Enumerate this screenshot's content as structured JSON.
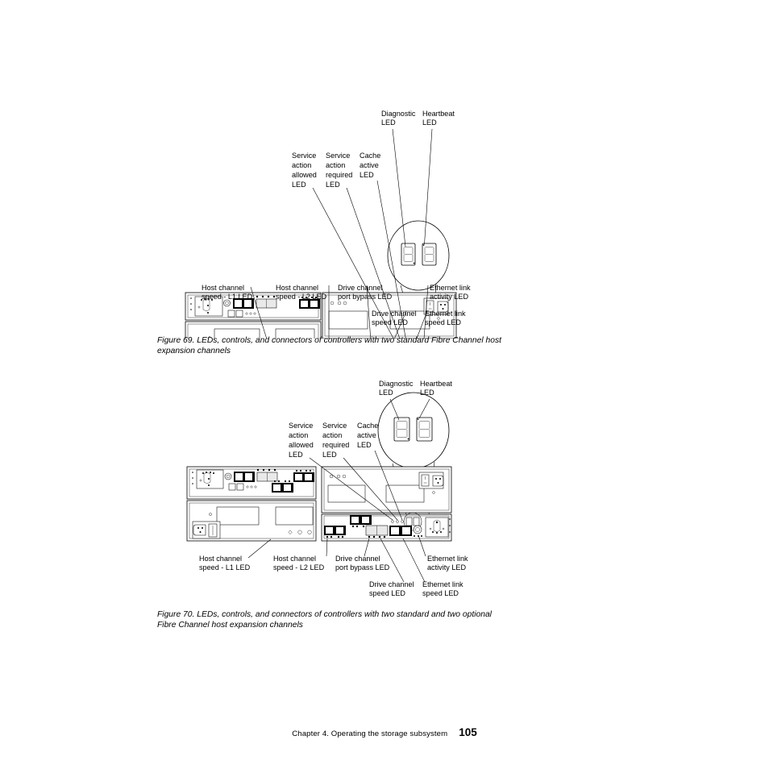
{
  "document": {
    "footer_chapter": "Chapter 4. Operating the storage subsystem",
    "footer_page_number": "105"
  },
  "figures": [
    {
      "id": "figure-69",
      "caption": "Figure 69. LEDs, controls, and connectors of controllers with two standard Fibre Channel host expansion channels",
      "callouts_top": [
        {
          "name": "diagnostic-led",
          "lines": [
            "Diagnostic",
            "LED"
          ]
        },
        {
          "name": "heartbeat-led",
          "lines": [
            "Heartbeat",
            "LED"
          ]
        },
        {
          "name": "service-action-allowed-led",
          "lines": [
            "Service",
            "action",
            "allowed",
            "LED"
          ]
        },
        {
          "name": "service-action-required-led",
          "lines": [
            "Service",
            "action",
            "required",
            "LED"
          ]
        },
        {
          "name": "cache-active-led",
          "lines": [
            "Cache",
            "active",
            "LED"
          ]
        }
      ],
      "callouts_bottom": [
        {
          "name": "host-channel-speed-l1-led",
          "lines": [
            "Host channel",
            "speed - L1 LED"
          ]
        },
        {
          "name": "host-channel-speed-l2-led",
          "lines": [
            "Host channel",
            "speed - L2 LED"
          ]
        },
        {
          "name": "drive-channel-port-bypass-led",
          "lines": [
            "Drive channel",
            "port bypass LED"
          ]
        },
        {
          "name": "ethernet-link-activity-led",
          "lines": [
            "Ethernet link",
            "activity LED"
          ]
        },
        {
          "name": "drive-channel-speed-led",
          "lines": [
            "Drive channel",
            "speed LED"
          ]
        },
        {
          "name": "ethernet-link-speed-led",
          "lines": [
            "Ethernet link",
            "speed LED"
          ]
        }
      ]
    },
    {
      "id": "figure-70",
      "caption": "Figure 70. LEDs, controls, and connectors of controllers with two standard and two optional Fibre Channel host expansion channels",
      "callouts_top": [
        {
          "name": "diagnostic-led",
          "lines": [
            "Diagnostic",
            "LED"
          ]
        },
        {
          "name": "heartbeat-led",
          "lines": [
            "Heartbeat",
            "LED"
          ]
        },
        {
          "name": "service-action-allowed-led",
          "lines": [
            "Service",
            "action",
            "allowed",
            "LED"
          ]
        },
        {
          "name": "service-action-required-led",
          "lines": [
            "Service",
            "action",
            "required",
            "LED"
          ]
        },
        {
          "name": "cache-active-led",
          "lines": [
            "Cache",
            "active",
            "LED"
          ]
        }
      ],
      "callouts_bottom": [
        {
          "name": "host-channel-speed-l1-led",
          "lines": [
            "Host channel",
            "speed - L1 LED"
          ]
        },
        {
          "name": "host-channel-speed-l2-led",
          "lines": [
            "Host channel",
            "speed - L2 LED"
          ]
        },
        {
          "name": "drive-channel-port-bypass-led",
          "lines": [
            "Drive channel",
            "port bypass LED"
          ]
        },
        {
          "name": "ethernet-link-activity-led",
          "lines": [
            "Ethernet link",
            "activity LED"
          ]
        },
        {
          "name": "drive-channel-speed-led",
          "lines": [
            "Drive channel",
            "speed LED"
          ]
        },
        {
          "name": "ethernet-link-speed-led",
          "lines": [
            "Ethernet link",
            "speed LED"
          ]
        }
      ]
    }
  ],
  "fig69": {
    "t_diag_1": "Diagnostic",
    "t_diag_2": "LED",
    "t_heart_1": "Heartbeat",
    "t_heart_2": "LED",
    "t_saa_1": "Service",
    "t_saa_2": "action",
    "t_saa_3": "allowed",
    "t_saa_4": "LED",
    "t_sar_1": "Service",
    "t_sar_2": "action",
    "t_sar_3": "required",
    "t_sar_4": "LED",
    "t_cache_1": "Cache",
    "t_cache_2": "active",
    "t_cache_3": "LED",
    "b_hc1_1": "Host channel",
    "b_hc1_2": "speed - L1 LED",
    "b_hc2_1": "Host channel",
    "b_hc2_2": "speed - L2 LED",
    "b_dcpb_1": "Drive channel",
    "b_dcpb_2": "port bypass LED",
    "b_ela_1": "Ethernet link",
    "b_ela_2": "activity LED",
    "b_dcs_1": "Drive channel",
    "b_dcs_2": "speed LED",
    "b_els_1": "Ethernet link",
    "b_els_2": "speed LED"
  },
  "fig70": {
    "t_diag_1": "Diagnostic",
    "t_diag_2": "LED",
    "t_heart_1": "Heartbeat",
    "t_heart_2": "LED",
    "t_saa_1": "Service",
    "t_saa_2": "action",
    "t_saa_3": "allowed",
    "t_saa_4": "LED",
    "t_sar_1": "Service",
    "t_sar_2": "action",
    "t_sar_3": "required",
    "t_sar_4": "LED",
    "t_cache_1": "Cache",
    "t_cache_2": "active",
    "t_cache_3": "LED",
    "b_hc1_1": "Host channel",
    "b_hc1_2": "speed - L1 LED",
    "b_hc2_1": "Host channel",
    "b_hc2_2": "speed - L2 LED",
    "b_dcpb_1": "Drive channel",
    "b_dcpb_2": "port bypass LED",
    "b_ela_1": "Ethernet link",
    "b_ela_2": "activity LED",
    "b_dcs_1": "Drive channel",
    "b_dcs_2": "speed LED",
    "b_els_1": "Ethernet link",
    "b_els_2": "speed LED"
  },
  "colors": {
    "ink": "#000000",
    "paper": "#ffffff",
    "panel_fill": "#f4f4f4",
    "port_fill": "#e9e9e9"
  }
}
